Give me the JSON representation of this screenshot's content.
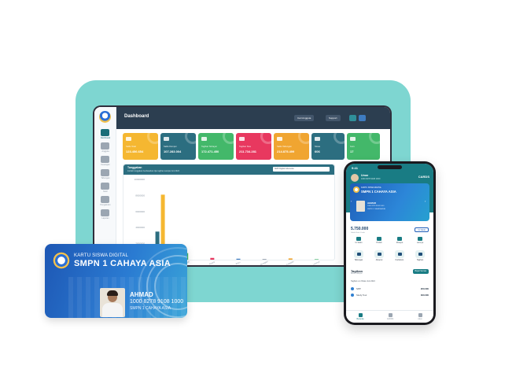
{
  "dashboard": {
    "title": "Dashboard",
    "buttons": [
      "Cari Anggota",
      "Support"
    ],
    "sidebar": [
      "Dashboard",
      "Anggota",
      "Keuangan",
      "Tabungan",
      "Kasir",
      "Pengaturan",
      "Laporan"
    ],
    "stat_cards": [
      {
        "label": "Saldo Total",
        "value": "123.456.654",
        "color": "#f5b731"
      },
      {
        "label": "Saldo Dompet",
        "value": "107.283.004",
        "color": "#2c6e80"
      },
      {
        "label": "Tagihan Terbayar",
        "value": "172.471.450",
        "color": "#43b86a"
      },
      {
        "label": "Tagihan Sisa",
        "value": "211.734.281",
        "color": "#e8385f"
      },
      {
        "label": "Saldo Tabungan",
        "value": "214.875.499",
        "color": "#f0a531"
      },
      {
        "label": "Siswa",
        "value": "606",
        "color": "#2c6e80"
      },
      {
        "label": "Guru",
        "value": "17",
        "color": "#43b86a"
      }
    ],
    "chart": {
      "title": "Tunggakan",
      "subtitle": "Jumlah tunggakan berdasarkan tipe tagihan sampai Juni 2024",
      "selector": "SMP Digital Indonesia"
    }
  },
  "chart_data": {
    "type": "bar",
    "categories": [
      "SPP",
      "Pangkal",
      "Ekstra",
      "Buku",
      "Seragam",
      "Kegiatan",
      "Lainnya"
    ],
    "series": [
      {
        "values": [
          3500000,
          0,
          0,
          0,
          0,
          0,
          0
        ],
        "color": "#2c6e80"
      },
      {
        "values": [
          8100000,
          0,
          0,
          0,
          0,
          0,
          0
        ],
        "color": "#f5b731"
      },
      {
        "values": [
          0,
          820000,
          0,
          0,
          0,
          0,
          0
        ],
        "color": "#43b86a"
      },
      {
        "values": [
          0,
          0,
          220000,
          0,
          0,
          0,
          0
        ],
        "color": "#e8385f"
      },
      {
        "values": [
          0,
          0,
          0,
          120000,
          0,
          0,
          0
        ],
        "color": "#3e7cc1"
      },
      {
        "values": [
          0,
          0,
          0,
          0,
          90000,
          0,
          0
        ],
        "color": "#9aa5b1"
      },
      {
        "values": [
          0,
          0,
          0,
          0,
          0,
          160000,
          0
        ],
        "color": "#f0a531"
      },
      {
        "values": [
          0,
          0,
          0,
          0,
          0,
          0,
          60000
        ],
        "color": "#43b86a"
      }
    ],
    "ylim": [
      0,
      10000000
    ],
    "yticks": [
      "10000000",
      "8000000",
      "6000000",
      "4000000",
      "2000000",
      "0"
    ],
    "grid": false
  },
  "phone": {
    "time": "9:41",
    "user_name": "Umar",
    "user_nisn": "1000 8278 9108 1000",
    "brand": "CARDS",
    "card_kicker": "KARTU SISWA DIGITAL",
    "card_school": "SMPN 1 CAHAYA ASIA",
    "student_name": "AHMAD",
    "student_id": "1000 8278 9108 1000",
    "student_school": "SMPN 1 CAHAYA ASIA",
    "saldo": "5.750.000",
    "saldo_label": "Saldo Kartu Cards",
    "topup": "Isi Saldo",
    "actions": [
      "Isi Saldo",
      "Pindah",
      "Riwayat",
      "Lainnya"
    ],
    "menus": [
      "Tabungan",
      "Absensi",
      "Kurikulum",
      "Tagihan"
    ],
    "tagihan_title": "Tagihan",
    "tagihan_sub": "Belum dibayar",
    "bayar": "Bayar Semua",
    "period": "Tagihan s.d. Bulan Juni 2024",
    "rows": [
      {
        "name": "SPP",
        "value": "200.000"
      },
      {
        "name": "Study Tour",
        "value": "300.000"
      }
    ],
    "nav": [
      "Beranda",
      "CARDS",
      "Akun"
    ]
  },
  "student_card": {
    "kicker": "KARTU SISWA DIGITAL",
    "school": "SMPN 1 CAHAYA ASIA",
    "name": "AHMAD",
    "number": "1000 8278 9108 1000",
    "school_small": "SMPN 1 CAHAYA ASIA"
  }
}
